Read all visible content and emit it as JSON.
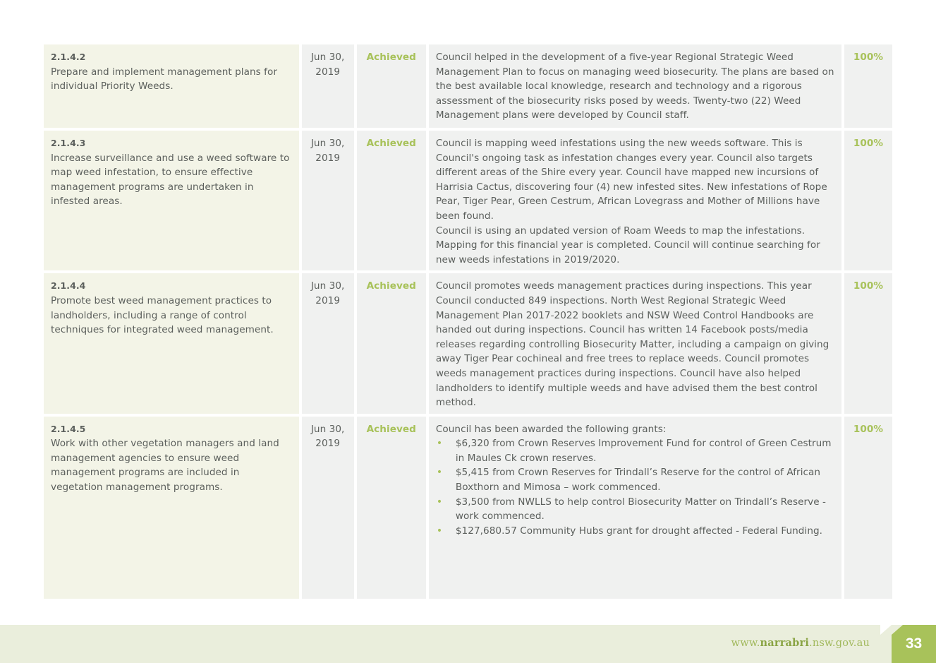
{
  "rows": [
    {
      "code": "2.1.4.2",
      "action": "Prepare and implement management plans for individual Priority Weeds.",
      "date_line1": "Jun 30,",
      "date_line2": "2019",
      "status": "Achieved",
      "comment": [
        "Council helped in the development of a five-year Regional Strategic Weed Management Plan to focus on managing weed biosecurity. The plans are based on the best available local knowledge, research and technology and a rigorous assessment of the biosecurity risks posed by weeds. Twenty-two (22) Weed Management plans were developed by Council staff."
      ],
      "progress": "100%"
    },
    {
      "code": "2.1.4.3",
      "action": "Increase surveillance and use a weed software to map weed infestation, to ensure effective management programs are undertaken in infested areas.",
      "date_line1": "Jun 30,",
      "date_line2": "2019",
      "status": "Achieved",
      "comment": [
        "Council is mapping weed infestations using the new weeds software. This is Council's ongoing task as infestation changes every year. Council also targets different areas of the Shire every year. Council have mapped new incursions of Harrisia Cactus, discovering four (4) new infested sites.  New infestations of Rope Pear, Tiger Pear, Green Cestrum, African Lovegrass and Mother of Millions have been found.",
        "Council is using an updated version of Roam Weeds to map the infestations. Mapping for this financial year is completed. Council will continue searching for new weeds infestations in 2019/2020."
      ],
      "progress": "100%"
    },
    {
      "code": "2.1.4.4",
      "action": "Promote best weed management practices to landholders, including a range of control techniques for integrated weed management.",
      "date_line1": "Jun 30,",
      "date_line2": "2019",
      "status": "Achieved",
      "comment": [
        "Council promotes weeds management practices during inspections. This year Council conducted 849 inspections. North West Regional Strategic Weed Management Plan 2017-2022 booklets and NSW Weed Control Handbooks are handed out during inspections. Council has written 14 Facebook posts/media releases regarding controlling Biosecurity Matter, including a campaign on giving away Tiger Pear cochineal and free trees to replace weeds.  Council promotes weeds management practices during inspections. Council have also helped landholders to identify multiple weeds and have advised them the best control method."
      ],
      "progress": "100%"
    },
    {
      "code": "2.1.4.5",
      "action": "Work with other vegetation managers and land management agencies to ensure weed management programs are included in vegetation management programs.",
      "date_line1": "Jun 30,",
      "date_line2": "2019",
      "status": "Achieved",
      "comment_intro": "Council has been awarded the following grants:",
      "grants": [
        "$6,320 from Crown Reserves Improvement Fund for control of Green Cestrum in Maules Ck crown reserves.",
        "$5,415 from Crown Reserves for Trindall’s Reserve for the control of African Boxthorn and Mimosa – work commenced.",
        "$3,500 from NWLLS to help control Biosecurity Matter on Trindall’s Reserve - work commenced.",
        "$127,680.57 Community Hubs grant for drought affected - Federal Funding."
      ],
      "progress": "100%"
    }
  ],
  "footer": {
    "url_prefix": "www.",
    "url_brand": "narrabri",
    "url_suffix": ".nsw.gov.au",
    "page_number": "33"
  },
  "colors": {
    "accent_green": "#a8c25a",
    "action_cell_bg": "#f3f4e7",
    "cell_bg": "#f0f1f0",
    "footer_bg": "#eaeedc"
  },
  "icons": {
    "bullet": "•"
  }
}
